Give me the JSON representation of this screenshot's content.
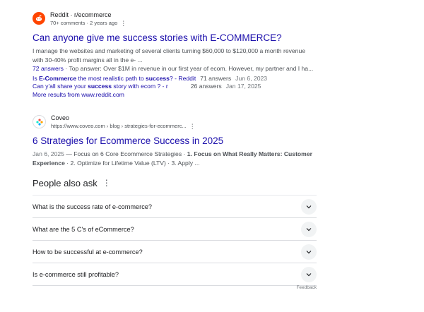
{
  "result_reddit": {
    "site_name": "Reddit · r/ecommerce",
    "site_sub": "70+ comments · 2 years ago",
    "kebab": "⋮",
    "title": "Can anyone give me success stories with E-COMMERCE?",
    "snippet_line1": "I manage the websites and marketing of several clients turning $60,000 to $120,000 a month revenue",
    "snippet_line2": "with 30-40% profit margins all in the e- ...",
    "answers_count": "72 answers",
    "answers_dot": " · ",
    "top_answer": "Top answer: Over $1M in revenue in our first year of ecom. However, my partner and I ha...",
    "sitelinks": [
      {
        "pre": "Is ",
        "bold": "E-Commerce",
        "mid": " the most realistic path to ",
        "bold2": "success",
        "post": "? - Reddit",
        "answers": "71 answers",
        "date": "Jun 6, 2023"
      },
      {
        "pre": "Can y'all share your ",
        "bold": "success",
        "mid": " story with ecom ? - r",
        "bold2": "",
        "post": "",
        "answers": "26 answers",
        "date": "Jan 17, 2025"
      }
    ],
    "more_results": "More results from www.reddit.com"
  },
  "result_coveo": {
    "site_name": "Coveo",
    "site_sub": "https://www.coveo.com › blog › strategies-for-ecommerc...",
    "kebab": "⋮",
    "title": "6 Strategies for Ecommerce Success in 2025",
    "date": "Jan 6, 2025",
    "dash": " — ",
    "snippet_a": "Focus on 6 Core Ecommerce Strategies · ",
    "snippet_b": "1. Focus on What Really Matters: Customer",
    "snippet_c": "Experience",
    "snippet_d": " · 2. Optimize for Lifetime Value (LTV) · 3. Apply ..."
  },
  "people_also_ask": {
    "heading": "People also ask",
    "menu_icon": "⋮",
    "questions": [
      "What is the success rate of e-commerce?",
      "What are the 5 C's of eCommerce?",
      "How to be successful at e-commerce?",
      "Is e-commerce still profitable?"
    ],
    "feedback": "Feedback"
  },
  "colors": {
    "link": "#1a0dab",
    "text": "#202124",
    "muted": "#4d5156",
    "reddit": "#ff4500"
  }
}
